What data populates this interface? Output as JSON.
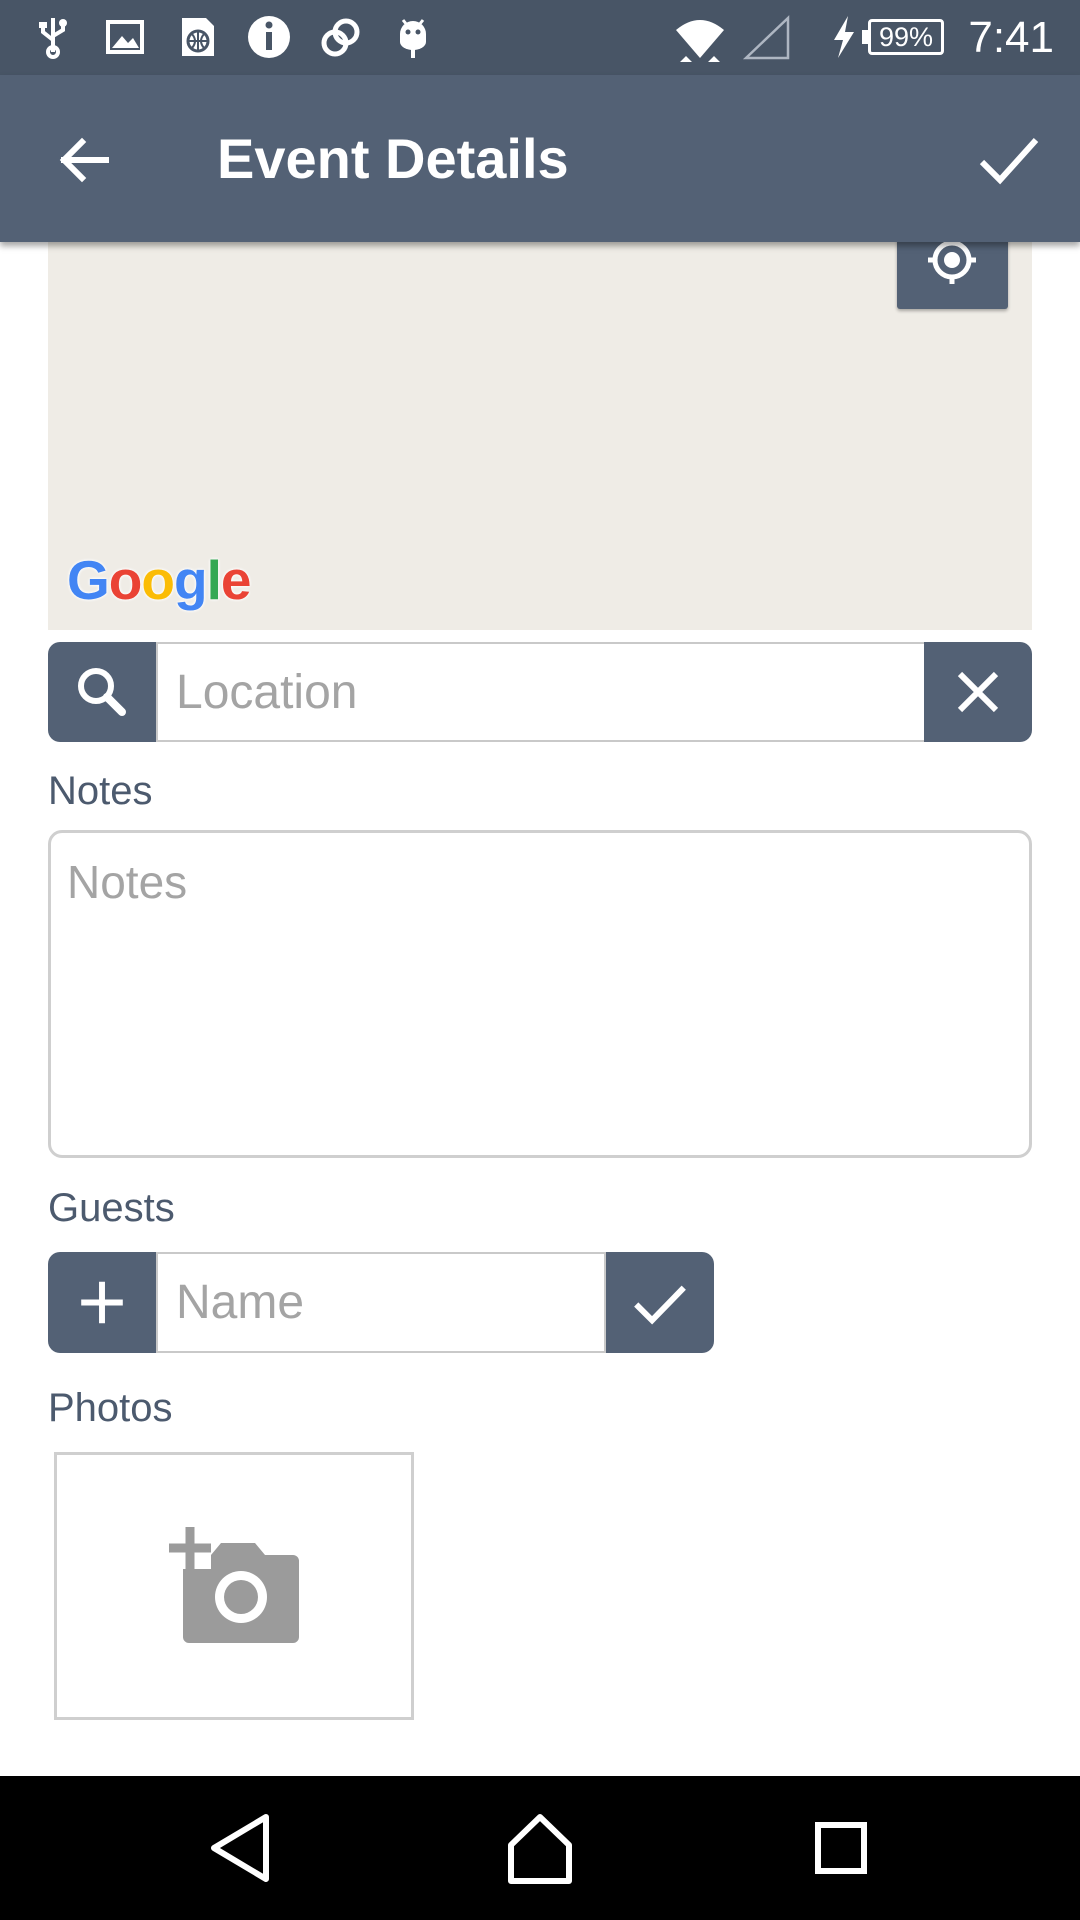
{
  "status_bar": {
    "battery": "99%",
    "time": "7:41",
    "left_icons": [
      "usb-icon",
      "image-icon",
      "sim-globe-icon",
      "info-icon",
      "sync-icon",
      "android-icon"
    ],
    "right_icons": [
      "wifi-icon",
      "signal-icon",
      "charging-icon",
      "battery-icon"
    ]
  },
  "app_bar": {
    "title": "Event Details",
    "back_icon": "arrow-back-icon",
    "confirm_icon": "check-icon"
  },
  "map": {
    "logo_letters": [
      "G",
      "o",
      "o",
      "g",
      "l",
      "e"
    ],
    "logo_colors": [
      "#4285F4",
      "#EA4335",
      "#FBBC05",
      "#4285F4",
      "#34A853",
      "#EA4335"
    ],
    "my_location_icon": "my-location-icon",
    "background_color": "#efece6"
  },
  "location": {
    "placeholder": "Location",
    "value": "",
    "search_icon": "search-icon",
    "clear_icon": "close-icon"
  },
  "notes": {
    "label": "Notes",
    "placeholder": "Notes",
    "value": ""
  },
  "guests": {
    "label": "Guests",
    "placeholder": "Name",
    "value": "",
    "add_icon": "plus-icon",
    "confirm_icon": "check-icon"
  },
  "photos": {
    "label": "Photos",
    "add_photo_icon": "add-photo-camera-icon"
  },
  "nav_bar": {
    "icons": [
      "back-triangle-icon",
      "home-icon",
      "recents-square-icon"
    ]
  },
  "colors": {
    "status_bar": "#485566",
    "app_bar": "#536175",
    "accent": "#536175",
    "label_text": "#4c5a6e",
    "placeholder_text": "#a4a4a4"
  }
}
